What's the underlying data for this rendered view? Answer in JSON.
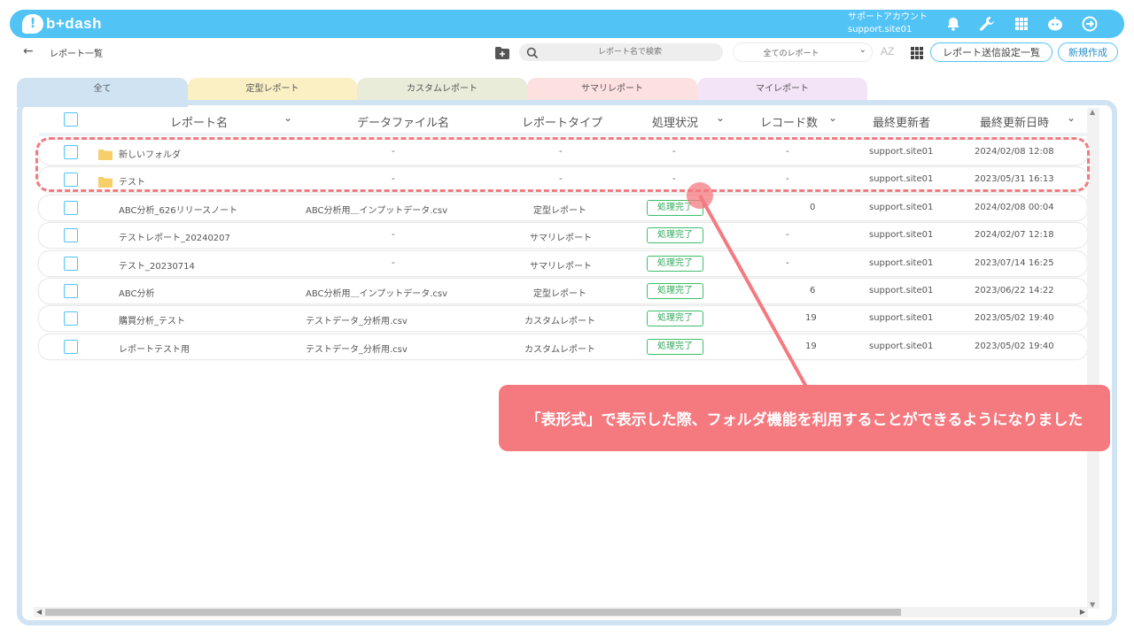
{
  "header": {
    "logo_text": "b+dash",
    "account_label": "サポートアカウント",
    "account_id": "support.site01",
    "icons": [
      "bell-icon",
      "wrench-icon",
      "apps-grid-icon",
      "assistant-icon",
      "logout-icon"
    ]
  },
  "subbar": {
    "back_arrow": "←",
    "title": "レポート一覧",
    "search_placeholder": "レポート名で検索",
    "filter_value": "全てのレポート",
    "sort_az": "AZ",
    "send_settings_button": "レポート送信設定一覧",
    "new_button": "新規作成"
  },
  "tabs": [
    {
      "label": "全て",
      "color": "#cfe3f3"
    },
    {
      "label": "定型レポート",
      "color": "#fbf0c4"
    },
    {
      "label": "カスタムレポート",
      "color": "#e9ecd9"
    },
    {
      "label": "サマリレポート",
      "color": "#fde0e0"
    },
    {
      "label": "マイレポート",
      "color": "#f4e4f8"
    }
  ],
  "table": {
    "headers": {
      "name": "レポート名",
      "file": "データファイル名",
      "type": "レポートタイプ",
      "status": "処理状況",
      "records": "レコード数",
      "updater": "最終更新者",
      "updated": "最終更新日時"
    },
    "rows": [
      {
        "name": "新しいフォルダ",
        "file": "-",
        "type": "-",
        "status": "-",
        "records": "-",
        "updater": "support.site01",
        "updated": "2024/02/08 12:08",
        "folder": true
      },
      {
        "name": "テスト",
        "file": "-",
        "type": "-",
        "status": "-",
        "records": "-",
        "updater": "support.site01",
        "updated": "2023/05/31 16:13",
        "folder": true
      },
      {
        "name": "ABC分析_626リリースノート",
        "file": "ABC分析用＿インプットデータ.csv",
        "type": "定型レポート",
        "status": "処理完了",
        "records": "0",
        "updater": "support.site01",
        "updated": "2024/02/08 00:04",
        "folder": false
      },
      {
        "name": "テストレポート_20240207",
        "file": "-",
        "type": "サマリレポート",
        "status": "処理完了",
        "records": "-",
        "updater": "support.site01",
        "updated": "2024/02/07 12:18",
        "folder": false
      },
      {
        "name": "テスト_20230714",
        "file": "-",
        "type": "サマリレポート",
        "status": "処理完了",
        "records": "-",
        "updater": "support.site01",
        "updated": "2023/07/14 16:25",
        "folder": false
      },
      {
        "name": "ABC分析",
        "file": "ABC分析用＿インプットデータ.csv",
        "type": "定型レポート",
        "status": "処理完了",
        "records": "6",
        "updater": "support.site01",
        "updated": "2023/06/22 14:22",
        "folder": false
      },
      {
        "name": "購買分析_テスト",
        "file": "テストデータ_分析用.csv",
        "type": "カスタムレポート",
        "status": "処理完了",
        "records": "19",
        "updater": "support.site01",
        "updated": "2023/05/02 19:40",
        "folder": false
      },
      {
        "name": "レポートテスト用",
        "file": "テストデータ_分析用.csv",
        "type": "カスタムレポート",
        "status": "処理完了",
        "records": "19",
        "updater": "support.site01",
        "updated": "2023/05/02 19:40",
        "folder": false
      }
    ]
  },
  "annotation": {
    "callout_text": "「表形式」で表示した際、フォルダ機能を利用することができるようになりました",
    "color": "#f47a7f"
  }
}
